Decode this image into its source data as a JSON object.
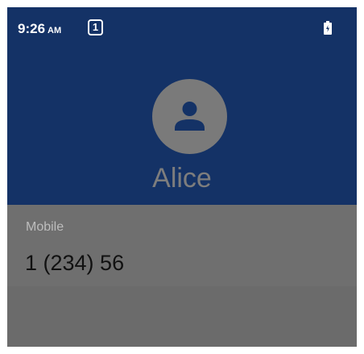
{
  "status_bar": {
    "time": "9:26",
    "ampm": "AM",
    "notification_count": "1",
    "battery_icon": "battery-charging-icon"
  },
  "contact": {
    "avatar_icon": "person-icon",
    "name": "Alice"
  },
  "phone": {
    "label": "Mobile",
    "number": "1 (234) 56"
  },
  "colors": {
    "header_bg": "#143266",
    "overlay_bg": "#6e6e6e",
    "name_text": "#7d7d7d"
  }
}
